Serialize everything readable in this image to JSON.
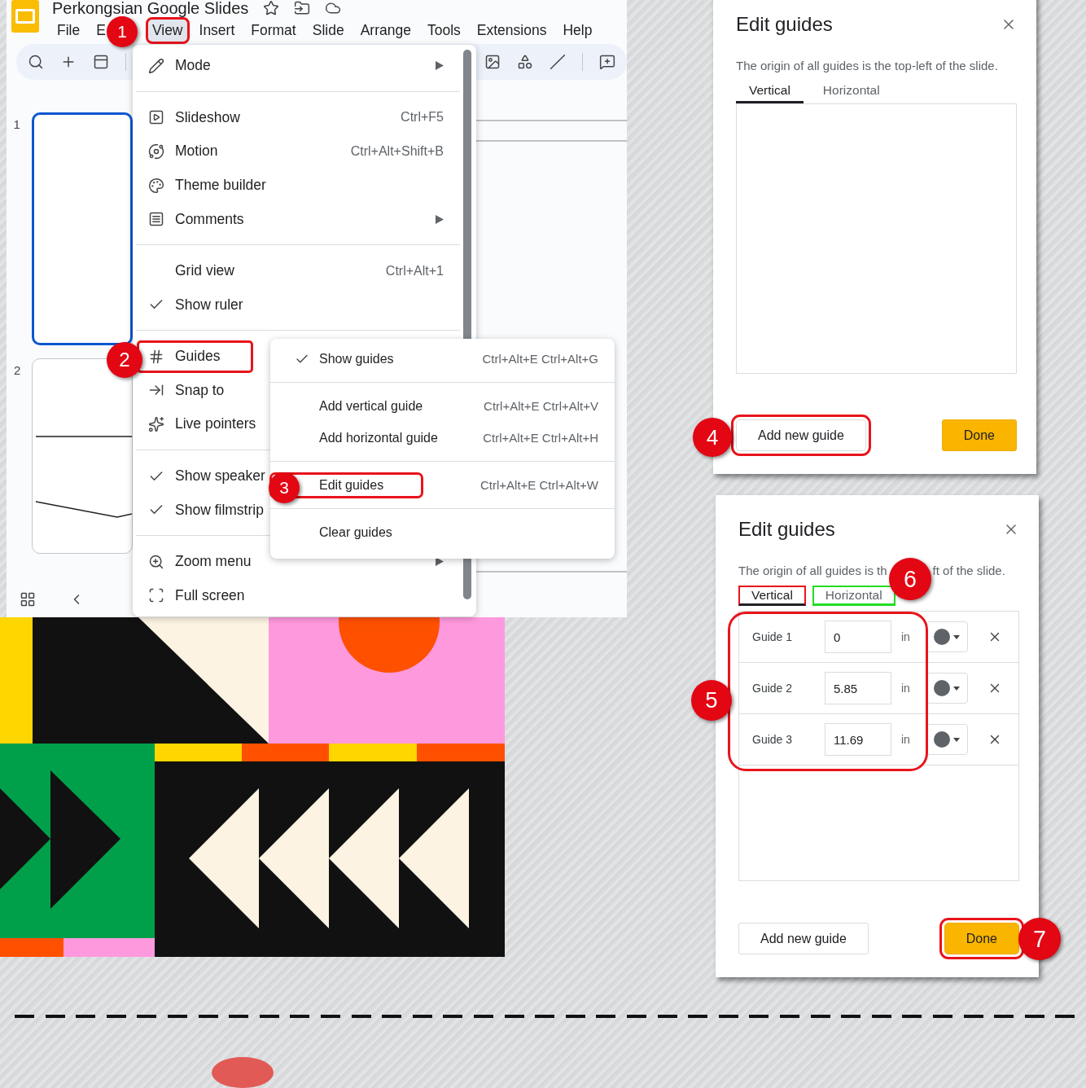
{
  "app": {
    "title": "Perkongsian Google Slides",
    "menus": [
      {
        "label": "File",
        "selected": false
      },
      {
        "label": "E",
        "selected": false
      },
      {
        "label": "View",
        "selected": true,
        "highlighted": true
      },
      {
        "label": "Insert",
        "selected": false
      },
      {
        "label": "Format",
        "selected": false
      },
      {
        "label": "Slide",
        "selected": false
      },
      {
        "label": "Arrange",
        "selected": false
      },
      {
        "label": "Tools",
        "selected": false
      },
      {
        "label": "Extensions",
        "selected": false
      },
      {
        "label": "Help",
        "selected": false
      }
    ],
    "slides": [
      {
        "number": "1",
        "selected": true
      },
      {
        "number": "2",
        "selected": false
      }
    ]
  },
  "view_menu": {
    "sections": [
      [
        {
          "label": "Mode",
          "checked": false,
          "submenu": true,
          "highlighted": false
        }
      ],
      [
        {
          "label": "Slideshow",
          "shortcut": "Ctrl+F5",
          "checked": false,
          "submenu": false,
          "highlighted": false
        },
        {
          "label": "Motion",
          "shortcut": "Ctrl+Alt+Shift+B",
          "checked": false,
          "submenu": false,
          "highlighted": false
        },
        {
          "label": "Theme builder",
          "checked": false,
          "submenu": false,
          "highlighted": false
        },
        {
          "label": "Comments",
          "checked": false,
          "submenu": true,
          "highlighted": false
        }
      ],
      [
        {
          "label": "Grid view",
          "shortcut": "Ctrl+Alt+1",
          "checked": false,
          "submenu": false,
          "highlighted": false
        },
        {
          "label": "Show ruler",
          "checked": true,
          "submenu": false,
          "highlighted": false
        }
      ],
      [
        {
          "label": "Guides",
          "checked": false,
          "submenu": false,
          "highlighted": true
        },
        {
          "label": "Snap to",
          "checked": false,
          "submenu": false,
          "highlighted": false
        },
        {
          "label": "Live pointers",
          "checked": false,
          "submenu": false,
          "highlighted": false
        }
      ],
      [
        {
          "label": "Show speaker",
          "checked": true,
          "submenu": false,
          "highlighted": false
        },
        {
          "label": "Show filmstrip",
          "checked": true,
          "submenu": false,
          "highlighted": false
        }
      ],
      [
        {
          "label": "Zoom menu",
          "checked": false,
          "submenu": true,
          "highlighted": false
        },
        {
          "label": "Full screen",
          "checked": false,
          "submenu": false,
          "highlighted": false
        }
      ]
    ]
  },
  "guides_submenu": {
    "sections": [
      [
        {
          "label": "Show guides",
          "shortcut": "Ctrl+Alt+E Ctrl+Alt+G",
          "checked": true,
          "highlighted": false
        }
      ],
      [
        {
          "label": "Add vertical guide",
          "shortcut": "Ctrl+Alt+E Ctrl+Alt+V",
          "checked": false,
          "highlighted": false
        },
        {
          "label": "Add horizontal guide",
          "shortcut": "Ctrl+Alt+E Ctrl+Alt+H",
          "checked": false,
          "highlighted": false
        }
      ],
      [
        {
          "label": "Edit guides",
          "shortcut": "Ctrl+Alt+E Ctrl+Alt+W",
          "checked": false,
          "highlighted": true
        }
      ],
      [
        {
          "label": "Clear guides",
          "checked": false,
          "highlighted": false
        }
      ]
    ]
  },
  "dialogs": [
    {
      "title": "Edit guides",
      "description_parts": [
        "The origin of all guides is the top-left of the slide."
      ],
      "tabs": [
        {
          "label": "Vertical",
          "selected": true
        },
        {
          "label": "Horizontal",
          "selected": false
        }
      ],
      "guides_highlighted": false,
      "buttons": [
        {
          "label": "Add new guide",
          "kind": "secondary",
          "highlighted": true
        },
        {
          "label": "Done",
          "kind": "primary",
          "highlighted": false
        }
      ]
    },
    {
      "title": "Edit guides",
      "description_parts": [
        "The origin of all guides is th",
        "ft of the slide."
      ],
      "tabs": [
        {
          "label": "Vertical",
          "selected": true,
          "color": "#e8141b"
        },
        {
          "label": "Horizontal",
          "selected": false,
          "color": "#22dd22"
        }
      ],
      "guides": [
        {
          "label": "Guide 1",
          "value": "0",
          "unit": "in"
        },
        {
          "label": "Guide 2",
          "value": "5.85",
          "unit": "in"
        },
        {
          "label": "Guide 3",
          "value": "11.69",
          "unit": "in"
        }
      ],
      "guides_highlighted": true,
      "buttons": [
        {
          "label": "Add new guide",
          "kind": "secondary",
          "highlighted": false
        },
        {
          "label": "Done",
          "kind": "primary",
          "highlighted": true
        }
      ]
    }
  ],
  "annotations": [
    {
      "number": "1"
    },
    {
      "number": "2"
    },
    {
      "number": "3"
    },
    {
      "number": "4"
    },
    {
      "number": "5"
    },
    {
      "number": "6"
    },
    {
      "number": "7"
    }
  ]
}
